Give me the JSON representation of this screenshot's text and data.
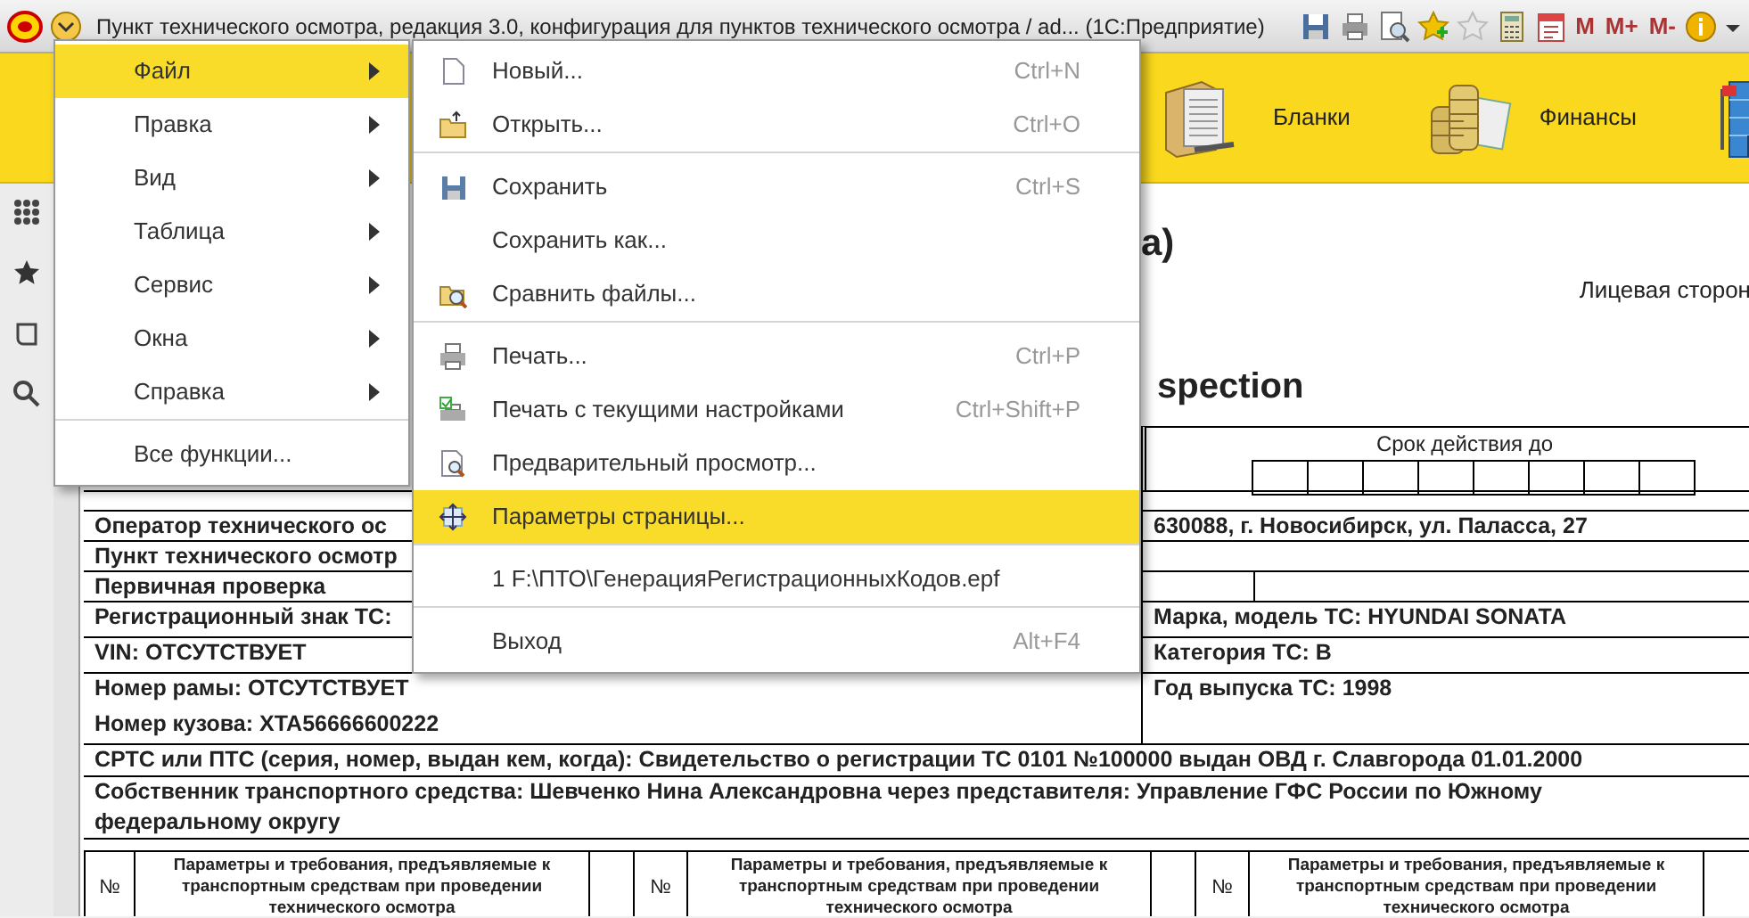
{
  "title_bar": {
    "title": "Пункт технического осмотра, редакция 3.0, конфигурация для пунктов технического осмотра / ad...  (1С:Предприятие)",
    "memory_buttons": [
      "M",
      "M+",
      "M-"
    ]
  },
  "sections": [
    {
      "label": "Бланки",
      "kind": "folder"
    },
    {
      "label": "Финансы",
      "kind": "coins"
    },
    {
      "kind": "building"
    }
  ],
  "main_menu": [
    {
      "label": "Файл",
      "selected": true,
      "submenu": true,
      "separator_before": false
    },
    {
      "label": "Правка",
      "selected": false,
      "submenu": true,
      "separator_before": false
    },
    {
      "label": "Вид",
      "selected": false,
      "submenu": true,
      "separator_before": false
    },
    {
      "label": "Таблица",
      "selected": false,
      "submenu": true,
      "separator_before": false
    },
    {
      "label": "Сервис",
      "selected": false,
      "submenu": true,
      "separator_before": false
    },
    {
      "label": "Окна",
      "selected": false,
      "submenu": true,
      "separator_before": false
    },
    {
      "label": "Справка",
      "selected": false,
      "submenu": true,
      "separator_before": false
    },
    {
      "label": "Все функции...",
      "selected": false,
      "submenu": false,
      "separator_before": true
    }
  ],
  "file_menu": [
    {
      "label": "Новый...",
      "shortcut": "Ctrl+N",
      "kind": "new",
      "selected": false,
      "separator_before": false
    },
    {
      "label": "Открыть...",
      "shortcut": "Ctrl+O",
      "kind": "open",
      "selected": false,
      "separator_before": false
    },
    {
      "label": "Сохранить",
      "shortcut": "Ctrl+S",
      "kind": "save",
      "selected": false,
      "separator_before": true
    },
    {
      "label": "Сохранить как...",
      "kind": "none",
      "selected": false,
      "separator_before": false
    },
    {
      "label": "Сравнить файлы...",
      "kind": "compare",
      "selected": false,
      "separator_before": false
    },
    {
      "label": "Печать...",
      "shortcut": "Ctrl+P",
      "kind": "print",
      "selected": false,
      "separator_before": true
    },
    {
      "label": "Печать с текущими настройками",
      "shortcut": "Ctrl+Shift+P",
      "kind": "print_check",
      "selected": false,
      "separator_before": false
    },
    {
      "label": "Предварительный просмотр...",
      "kind": "preview",
      "selected": false,
      "separator_before": false
    },
    {
      "label": "Параметры страницы...",
      "kind": "page_setup",
      "selected": true,
      "separator_before": false
    },
    {
      "label": "1 F:\\ПТО\\ГенерацияРегистрационныхКодов.epf",
      "kind": "none",
      "selected": false,
      "separator_before": true
    },
    {
      "label": "Выход",
      "shortcut": "Alt+F4",
      "kind": "none",
      "selected": false,
      "separator_before": true
    }
  ],
  "document": {
    "heading": "а)",
    "side_label": "Лицевая сторон",
    "title_part": "spection",
    "valid_until": "Срок действия до",
    "rows": [
      {
        "left": "Оператор технического ос",
        "right": "630088, г. Новосибирск, ул. Паласса, 27"
      },
      {
        "left": "Пункт технического осмотр"
      },
      {
        "left": "Первичная проверка"
      },
      {
        "left": "Регистрационный знак ТС:",
        "right": "Марка, модель ТС: HYUNDAI SONATA"
      },
      {
        "left": "VIN: ОТСУТСТВУЕТ",
        "right": "Категория ТС: В"
      },
      {
        "left": "Номер рамы: ОТСУТСТВУЕТ",
        "right": "Год выпуска ТС: 1998"
      },
      {
        "left": "Номер кузова: XTA56666600222"
      }
    ],
    "full_rows": [
      "СРТС или ПТС (серия, номер, выдан кем, когда): Свидетельство о регистрации ТС 0101 №100000 выдан ОВД г. Славгорода 01.01.2000",
      "Собственник транспортного средства: Шевченко Нина Александровна  через представителя: Управление ГФС России по Южному федеральному округу"
    ],
    "param_columns": [
      {
        "number": "№",
        "text": "Параметры и требования, предъявляемые к транспортным средствам при проведении технического осмотра"
      },
      {
        "number": "№",
        "text": "Параметры и требования, предъявляемые к транспортным средствам при проведении технического осмотра"
      },
      {
        "number": "№",
        "text": "Параметры и требования, предъявляемые к транспортным средствам при проведении технического осмотра"
      }
    ]
  }
}
